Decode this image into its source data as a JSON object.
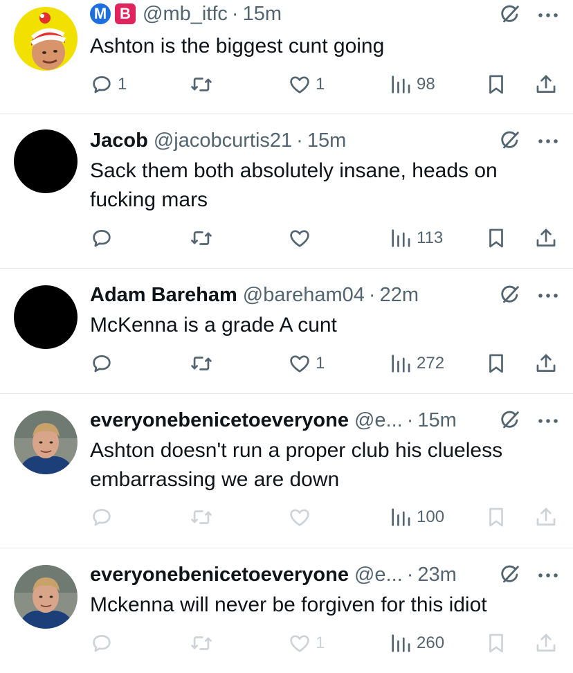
{
  "colors": {
    "icon_gray": "#536471",
    "text": "#0f1419",
    "divider": "#e1e6ea",
    "badge_m": "#1d6fe0",
    "badge_b": "#e0245e"
  },
  "tweets": [
    {
      "badges": [
        "M",
        "B"
      ],
      "name": "",
      "handle": "@mb_itfc",
      "time": "15m",
      "lines": [
        "Ashton is the biggest cunt going"
      ],
      "replies": "1",
      "retweets": "",
      "likes": "1",
      "views": "98",
      "avatar": "cartoon-bobble-hat"
    },
    {
      "name": "Jacob",
      "handle": "@jacobcurtis21",
      "time": "15m",
      "lines": [
        "Sack them both absolutely insane, heads on",
        "fucking mars"
      ],
      "replies": "",
      "retweets": "",
      "likes": "",
      "views": "113",
      "avatar": "black"
    },
    {
      "name": "Adam Bareham",
      "handle": "@bareham04",
      "time": "22m",
      "lines": [
        "McKenna is a grade A cunt"
      ],
      "replies": "",
      "retweets": "",
      "likes": "1",
      "views": "272",
      "avatar": "black"
    },
    {
      "name": "everyonebenicetoeveryone",
      "handle": "@e...",
      "time": "15m",
      "lines": [
        "Ashton doesn't run a proper club his clueless",
        "embarrassing we are down"
      ],
      "replies": "",
      "retweets": "",
      "likes": "",
      "views": "100",
      "avatar": "photo"
    },
    {
      "name": "everyonebenicetoeveryone",
      "handle": "@e...",
      "time": "23m",
      "lines": [
        "Mckenna will never be forgiven for this idiot"
      ],
      "replies": "",
      "retweets": "",
      "likes": "1",
      "views": "260",
      "avatar": "photo"
    }
  ]
}
